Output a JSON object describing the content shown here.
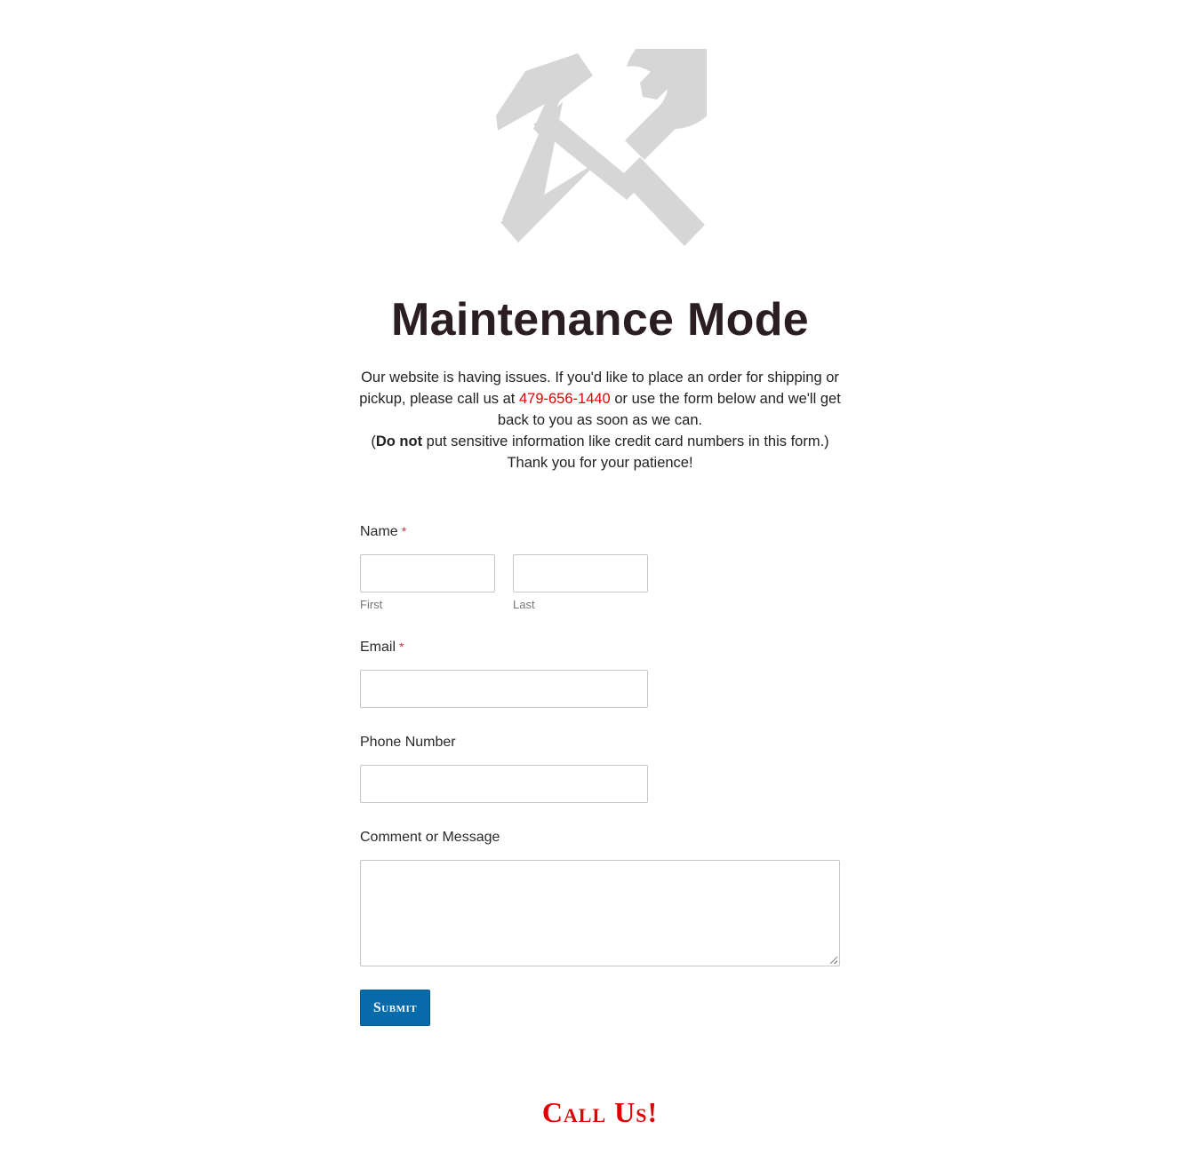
{
  "page": {
    "title": "Maintenance Mode",
    "intro": {
      "line1_before_phone": "Our website is having issues. If you'd like to place an order for shipping or pickup, please call us at ",
      "phone": "479-656-1440",
      "line1_after_phone": " or use the form below and we'll get back to you as soon as we can.",
      "warning_open": "(",
      "warning_bold": "Do not",
      "warning_rest": " put sensitive information like credit card numbers in this form.)",
      "thanks": "Thank you for your patience!"
    },
    "logo_icon": "hammer-and-wrench-icon"
  },
  "form": {
    "name": {
      "label": "Name",
      "required_mark": "*",
      "first": {
        "value": "",
        "sublabel": "First"
      },
      "last": {
        "value": "",
        "sublabel": "Last"
      }
    },
    "email": {
      "label": "Email",
      "required_mark": "*",
      "value": ""
    },
    "phone": {
      "label": "Phone Number",
      "value": ""
    },
    "comment": {
      "label": "Comment or Message",
      "value": ""
    },
    "submit_label": "Submit"
  },
  "footer": {
    "call_us": "Call Us!"
  },
  "colors": {
    "accent_red": "#e00000",
    "button_blue": "#066aab",
    "required_red": "#d63637",
    "logo_gray": "#d6d6d6"
  }
}
